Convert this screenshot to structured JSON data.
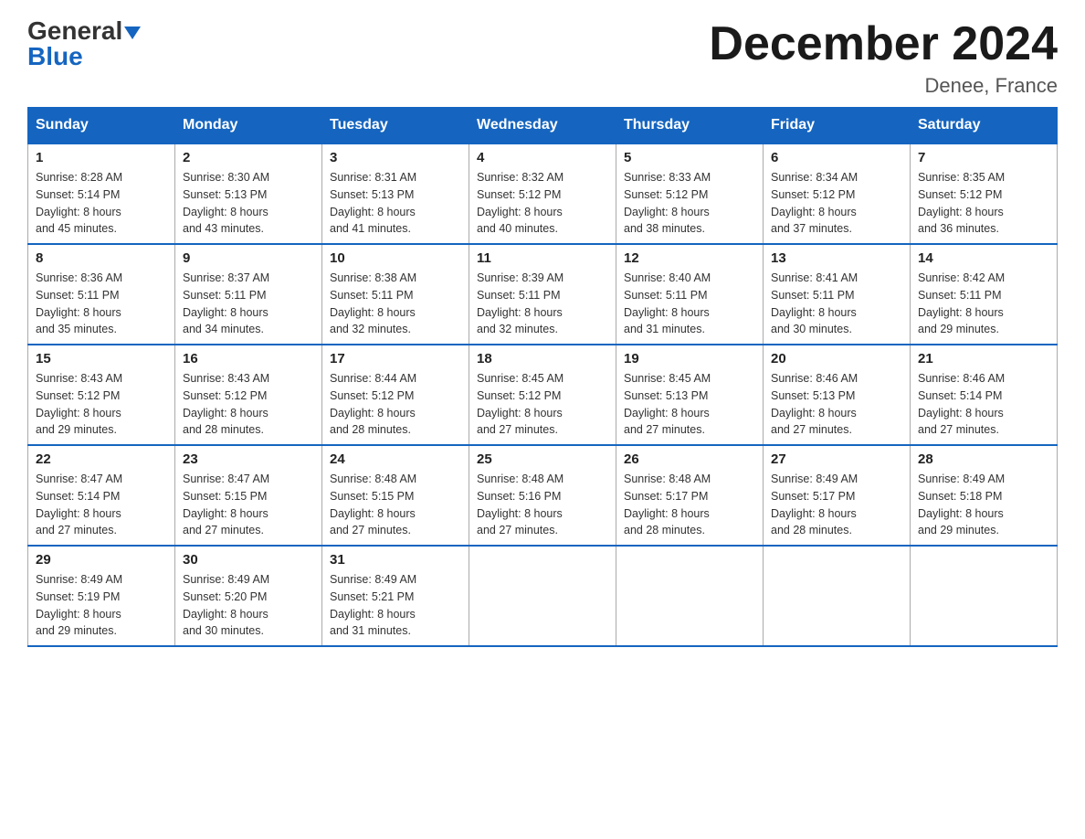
{
  "logo": {
    "general": "General",
    "blue": "Blue"
  },
  "title": "December 2024",
  "location": "Denee, France",
  "days_of_week": [
    "Sunday",
    "Monday",
    "Tuesday",
    "Wednesday",
    "Thursday",
    "Friday",
    "Saturday"
  ],
  "weeks": [
    [
      {
        "day": "1",
        "sunrise": "8:28 AM",
        "sunset": "5:14 PM",
        "daylight": "8 hours and 45 minutes."
      },
      {
        "day": "2",
        "sunrise": "8:30 AM",
        "sunset": "5:13 PM",
        "daylight": "8 hours and 43 minutes."
      },
      {
        "day": "3",
        "sunrise": "8:31 AM",
        "sunset": "5:13 PM",
        "daylight": "8 hours and 41 minutes."
      },
      {
        "day": "4",
        "sunrise": "8:32 AM",
        "sunset": "5:12 PM",
        "daylight": "8 hours and 40 minutes."
      },
      {
        "day": "5",
        "sunrise": "8:33 AM",
        "sunset": "5:12 PM",
        "daylight": "8 hours and 38 minutes."
      },
      {
        "day": "6",
        "sunrise": "8:34 AM",
        "sunset": "5:12 PM",
        "daylight": "8 hours and 37 minutes."
      },
      {
        "day": "7",
        "sunrise": "8:35 AM",
        "sunset": "5:12 PM",
        "daylight": "8 hours and 36 minutes."
      }
    ],
    [
      {
        "day": "8",
        "sunrise": "8:36 AM",
        "sunset": "5:11 PM",
        "daylight": "8 hours and 35 minutes."
      },
      {
        "day": "9",
        "sunrise": "8:37 AM",
        "sunset": "5:11 PM",
        "daylight": "8 hours and 34 minutes."
      },
      {
        "day": "10",
        "sunrise": "8:38 AM",
        "sunset": "5:11 PM",
        "daylight": "8 hours and 32 minutes."
      },
      {
        "day": "11",
        "sunrise": "8:39 AM",
        "sunset": "5:11 PM",
        "daylight": "8 hours and 32 minutes."
      },
      {
        "day": "12",
        "sunrise": "8:40 AM",
        "sunset": "5:11 PM",
        "daylight": "8 hours and 31 minutes."
      },
      {
        "day": "13",
        "sunrise": "8:41 AM",
        "sunset": "5:11 PM",
        "daylight": "8 hours and 30 minutes."
      },
      {
        "day": "14",
        "sunrise": "8:42 AM",
        "sunset": "5:11 PM",
        "daylight": "8 hours and 29 minutes."
      }
    ],
    [
      {
        "day": "15",
        "sunrise": "8:43 AM",
        "sunset": "5:12 PM",
        "daylight": "8 hours and 29 minutes."
      },
      {
        "day": "16",
        "sunrise": "8:43 AM",
        "sunset": "5:12 PM",
        "daylight": "8 hours and 28 minutes."
      },
      {
        "day": "17",
        "sunrise": "8:44 AM",
        "sunset": "5:12 PM",
        "daylight": "8 hours and 28 minutes."
      },
      {
        "day": "18",
        "sunrise": "8:45 AM",
        "sunset": "5:12 PM",
        "daylight": "8 hours and 27 minutes."
      },
      {
        "day": "19",
        "sunrise": "8:45 AM",
        "sunset": "5:13 PM",
        "daylight": "8 hours and 27 minutes."
      },
      {
        "day": "20",
        "sunrise": "8:46 AM",
        "sunset": "5:13 PM",
        "daylight": "8 hours and 27 minutes."
      },
      {
        "day": "21",
        "sunrise": "8:46 AM",
        "sunset": "5:14 PM",
        "daylight": "8 hours and 27 minutes."
      }
    ],
    [
      {
        "day": "22",
        "sunrise": "8:47 AM",
        "sunset": "5:14 PM",
        "daylight": "8 hours and 27 minutes."
      },
      {
        "day": "23",
        "sunrise": "8:47 AM",
        "sunset": "5:15 PM",
        "daylight": "8 hours and 27 minutes."
      },
      {
        "day": "24",
        "sunrise": "8:48 AM",
        "sunset": "5:15 PM",
        "daylight": "8 hours and 27 minutes."
      },
      {
        "day": "25",
        "sunrise": "8:48 AM",
        "sunset": "5:16 PM",
        "daylight": "8 hours and 27 minutes."
      },
      {
        "day": "26",
        "sunrise": "8:48 AM",
        "sunset": "5:17 PM",
        "daylight": "8 hours and 28 minutes."
      },
      {
        "day": "27",
        "sunrise": "8:49 AM",
        "sunset": "5:17 PM",
        "daylight": "8 hours and 28 minutes."
      },
      {
        "day": "28",
        "sunrise": "8:49 AM",
        "sunset": "5:18 PM",
        "daylight": "8 hours and 29 minutes."
      }
    ],
    [
      {
        "day": "29",
        "sunrise": "8:49 AM",
        "sunset": "5:19 PM",
        "daylight": "8 hours and 29 minutes."
      },
      {
        "day": "30",
        "sunrise": "8:49 AM",
        "sunset": "5:20 PM",
        "daylight": "8 hours and 30 minutes."
      },
      {
        "day": "31",
        "sunrise": "8:49 AM",
        "sunset": "5:21 PM",
        "daylight": "8 hours and 31 minutes."
      },
      null,
      null,
      null,
      null
    ]
  ],
  "labels": {
    "sunrise": "Sunrise:",
    "sunset": "Sunset:",
    "daylight": "Daylight:"
  }
}
